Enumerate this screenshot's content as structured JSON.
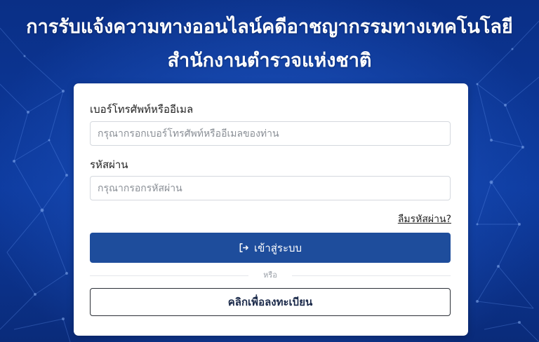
{
  "header": {
    "title_line1": "การรับแจ้งความทางออนไลน์คดีอาชญากรรมทางเทคโนโลยี",
    "title_line2": "สำนักงานตำรวจแห่งชาติ"
  },
  "login_form": {
    "phone_email_label": "เบอร์โทรศัพท์หรืออีเมล",
    "phone_email_value": "",
    "phone_email_placeholder": "กรุณากรอกเบอร์โทรศัพท์หรืออีเมลของท่าน",
    "password_label": "รหัสผ่าน",
    "password_value": "",
    "password_placeholder": "กรุณากรอกรหัสผ่าน",
    "forgot_password": "ลืมรหัสผ่าน?",
    "login_button": "เข้าสู่ระบบ",
    "login_icon": "sign-in-icon",
    "divider_text": "หรือ",
    "register_button": "คลิกเพื่อลงทะเบียน"
  },
  "colors": {
    "background": "#0b2f86",
    "primary_button": "#1e4d9c",
    "card": "#ffffff"
  }
}
